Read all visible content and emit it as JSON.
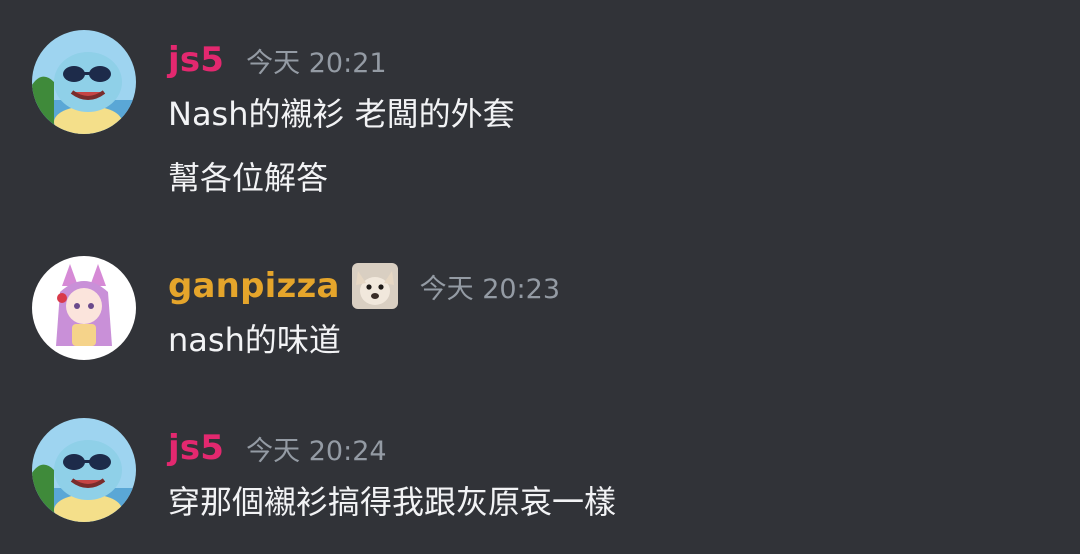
{
  "colors": {
    "background": "#313338",
    "username_js5": "#e3286f",
    "username_ganpizza": "#e5a52b",
    "timestamp": "#949ba4",
    "message_text": "#f2f3f5"
  },
  "messages": [
    {
      "avatar": "squirtle-sunglasses-avatar",
      "username": "js5",
      "timestamp": "今天 20:21",
      "lines": [
        "Nash的襯衫 老闆的外套",
        "幫各位解答"
      ]
    },
    {
      "avatar": "anime-catgirl-avatar",
      "username": "ganpizza",
      "role_icon": "dog-face-role-icon",
      "timestamp": "今天 20:23",
      "lines": [
        "nash的味道"
      ]
    },
    {
      "avatar": "squirtle-sunglasses-avatar",
      "username": "js5",
      "timestamp": "今天 20:24",
      "lines": [
        "穿那個襯衫搞得我跟灰原哀一樣"
      ]
    }
  ]
}
